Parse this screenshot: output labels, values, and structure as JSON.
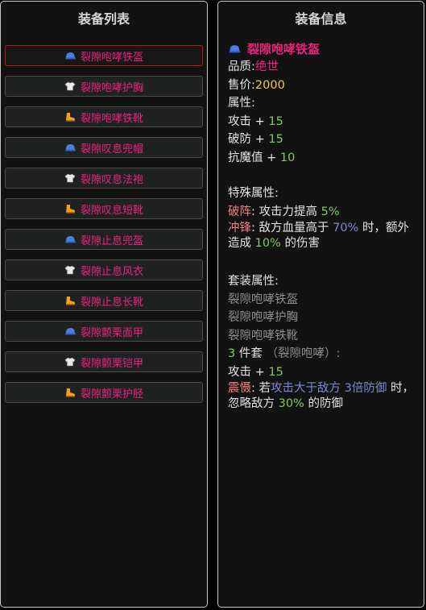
{
  "left_panel": {
    "title": "装备列表",
    "items": [
      {
        "label": "裂隙咆哮铁盔",
        "icon": "cap-icon",
        "selected": true
      },
      {
        "label": "裂隙咆哮护胸",
        "icon": "shirt-icon"
      },
      {
        "label": "裂隙咆哮铁靴",
        "icon": "boot-icon"
      },
      {
        "label": "裂隙叹息兜帽",
        "icon": "cap-icon"
      },
      {
        "label": "裂隙叹息法袍",
        "icon": "shirt-icon"
      },
      {
        "label": "裂隙叹息短靴",
        "icon": "boot-icon"
      },
      {
        "label": "裂隙止息兜盔",
        "icon": "cap-icon"
      },
      {
        "label": "裂隙止息风衣",
        "icon": "shirt-icon"
      },
      {
        "label": "裂隙止息长靴",
        "icon": "boot-icon"
      },
      {
        "label": "裂隙颤栗面甲",
        "icon": "cap-icon"
      },
      {
        "label": "裂隙颤栗铠甲",
        "icon": "shirt-icon"
      },
      {
        "label": "裂隙颤栗护胫",
        "icon": "boot-icon"
      }
    ]
  },
  "right_panel": {
    "title": "装备信息",
    "item_name": "裂隙咆哮铁盔",
    "item_icon": "cap-icon",
    "quality_label": "品质:",
    "quality_value": "绝世",
    "price_label": "售价:",
    "price_value": "2000",
    "attributes_label": "属性:",
    "attributes": [
      {
        "name": "攻击",
        "op": "+",
        "value": "15"
      },
      {
        "name": "破防",
        "op": "+",
        "value": "15"
      },
      {
        "name": "抗魔值",
        "op": "+",
        "value": "10"
      }
    ],
    "special_label": "特殊属性:",
    "special": [
      {
        "name": "破阵",
        "text1": "攻击力提高",
        "value": "5%"
      },
      {
        "name": "冲锋",
        "text1": "敌方血量高于",
        "value1": "70%",
        "text2": "时，额外造成",
        "value2": "10%",
        "text3": "的伤害"
      }
    ],
    "set_label": "套装属性:",
    "set_items": [
      "裂隙咆哮铁盔",
      "裂隙咆哮护胸",
      "裂隙咆哮铁靴"
    ],
    "set_bonus_count": "3",
    "set_bonus_unit": "件套",
    "set_bonus_name": "（裂隙咆哮）:",
    "set_attribute": {
      "name": "攻击",
      "op": "+",
      "value": "15"
    },
    "set_special": {
      "name": "震慑",
      "text1": "若",
      "cond": "攻击大于敌方 3倍防御",
      "text2": "时，忽略敌方",
      "value": "30%",
      "text3": "的防御"
    },
    "colors": {
      "item_name": "#e8247c",
      "quality": "#e8247c",
      "price": "#f2c94c",
      "value": "#7ccc5c",
      "special_name": "#f08080",
      "highlight": "#7d86d4",
      "set_inactive": "#8d8d8d"
    }
  }
}
